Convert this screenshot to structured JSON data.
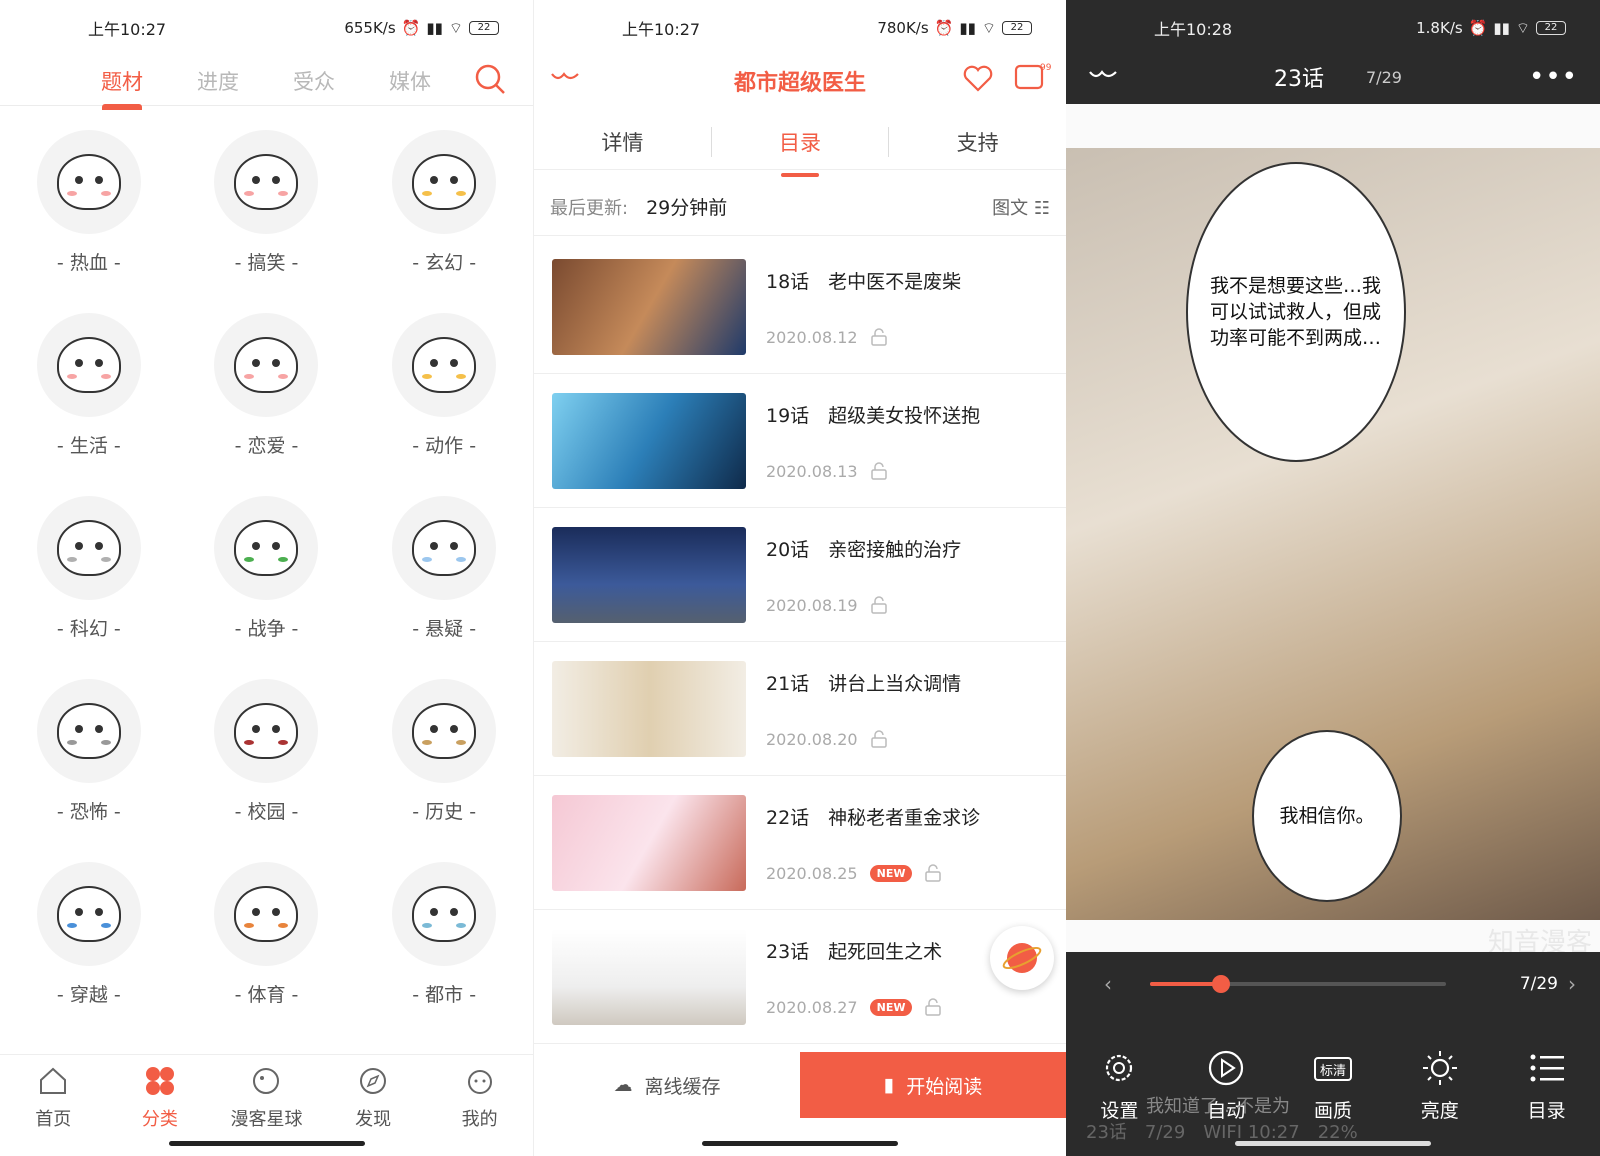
{
  "panel1": {
    "status": {
      "time": "上午10:27",
      "speed": "655K/s",
      "battery": "22"
    },
    "tabs": [
      "题材",
      "进度",
      "受众",
      "媒体"
    ],
    "active_tab": 0,
    "categories": [
      "- 热血 -",
      "- 搞笑 -",
      "- 玄幻 -",
      "- 生活 -",
      "- 恋爱 -",
      "- 动作 -",
      "- 科幻 -",
      "- 战争 -",
      "- 悬疑 -",
      "- 恐怖 -",
      "- 校园 -",
      "- 历史 -",
      "- 穿越 -",
      "- 体育 -",
      "- 都市 -"
    ],
    "nav": [
      "首页",
      "分类",
      "漫客星球",
      "发现",
      "我的"
    ],
    "active_nav": 1
  },
  "panel2": {
    "status": {
      "time": "上午10:27",
      "speed": "780K/s",
      "battery": "22"
    },
    "title": "都市超级医生",
    "msg_badge": "99+",
    "tabs": [
      "详情",
      "目录",
      "支持"
    ],
    "active_tab": 1,
    "update_label": "最后更新:",
    "update_value": "29分钟前",
    "view_mode": "图文",
    "chapters": [
      {
        "name": "18话　老中医不是废柴",
        "date": "2020.08.12",
        "new": false
      },
      {
        "name": "19话　超级美女投怀送抱",
        "date": "2020.08.13",
        "new": false
      },
      {
        "name": "20话　亲密接触的治疗",
        "date": "2020.08.19",
        "new": false
      },
      {
        "name": "21话　讲台上当众调情",
        "date": "2020.08.20",
        "new": false
      },
      {
        "name": "22话　神秘老者重金求诊",
        "date": "2020.08.25",
        "new": true
      },
      {
        "name": "23话　起死回生之术",
        "date": "2020.08.27",
        "new": true
      }
    ],
    "new_label": "NEW",
    "offline_label": "离线缓存",
    "read_label": "开始阅读"
  },
  "panel3": {
    "status": {
      "time": "上午10:28",
      "speed": "1.8K/s",
      "battery": "22"
    },
    "chapter_title": "23话",
    "page": "7/29",
    "bubble1": "我不是想要这些…我可以试试救人，但成功率可能不到两成…",
    "bubble2": "我相信你。",
    "watermark": "知音漫客",
    "progress": 0.24,
    "controls": [
      "设置",
      "自动",
      "画质",
      "亮度",
      "目录"
    ],
    "quality_badge": "标清",
    "overlay_text": "我知道了…不是为",
    "overlay_footer": "23话　7/29　WIFI 10:27　22%"
  },
  "colors": {
    "accent": "#f25d45",
    "dark": "#2b2b2b"
  }
}
